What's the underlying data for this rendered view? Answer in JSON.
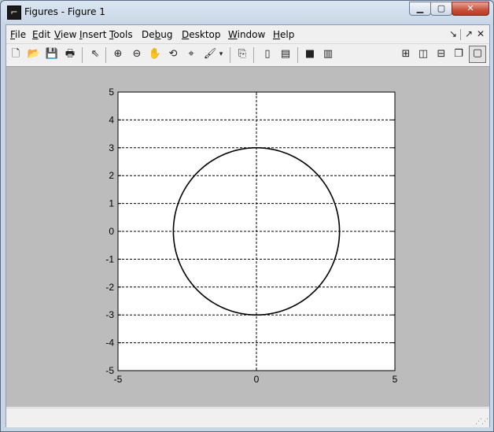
{
  "window": {
    "title": "Figures - Figure 1",
    "app_icon": "matlab-icon",
    "controls": {
      "minimize": "minimize-icon",
      "maximize": "maximize-icon",
      "close": "close-icon"
    }
  },
  "menubar": {
    "items": [
      {
        "key": "F",
        "rest": "ile"
      },
      {
        "key": "E",
        "rest": "dit"
      },
      {
        "key": "V",
        "rest": "iew"
      },
      {
        "key": "I",
        "rest": "nsert"
      },
      {
        "key": "T",
        "rest": "ools"
      },
      {
        "pre": "De",
        "key": "b",
        "rest": "ug"
      },
      {
        "key": "D",
        "rest": "esktop"
      },
      {
        "key": "W",
        "rest": "indow"
      },
      {
        "key": "H",
        "rest": "elp"
      }
    ],
    "right_icons": [
      "undock-arrow-icon",
      "dock-arrow-icon",
      "close-figure-icon"
    ]
  },
  "toolbar": {
    "icons": [
      "new-figure-icon",
      "open-file-icon",
      "save-icon",
      "print-icon",
      "pointer-icon",
      "zoom-in-icon",
      "zoom-out-icon",
      "pan-hand-icon",
      "rotate-3d-icon",
      "data-cursor-icon",
      "brush-icon",
      "brush-dropdown-icon",
      "link-plot-icon",
      "colorbar-icon",
      "legend-icon",
      "hide-plot-tools-icon",
      "show-plot-tools-icon",
      "tile-grid-icon",
      "tile-columns-icon",
      "tile-rows-icon",
      "float-icon",
      "maximize-figure-icon"
    ]
  },
  "chart_data": {
    "type": "line",
    "title": "",
    "xlabel": "",
    "ylabel": "",
    "xlim": [
      -5,
      5
    ],
    "ylim": [
      -5,
      5
    ],
    "xticks": [
      -5,
      0,
      5
    ],
    "yticks": [
      -5,
      -4,
      -3,
      -2,
      -1,
      0,
      1,
      2,
      3,
      4,
      5
    ],
    "grid": {
      "x_lines_at": [
        0
      ],
      "y_lines_at": [
        -4,
        -3,
        -2,
        -1,
        0,
        1,
        2,
        3,
        4
      ],
      "style": "dashed"
    },
    "series": [
      {
        "shape": "circle",
        "center": [
          0,
          0
        ],
        "radius": 3,
        "color": "#000000"
      }
    ]
  },
  "colors": {
    "figure_background": "#bcbcbc",
    "axes_background": "#ffffff",
    "line": "#000000"
  }
}
